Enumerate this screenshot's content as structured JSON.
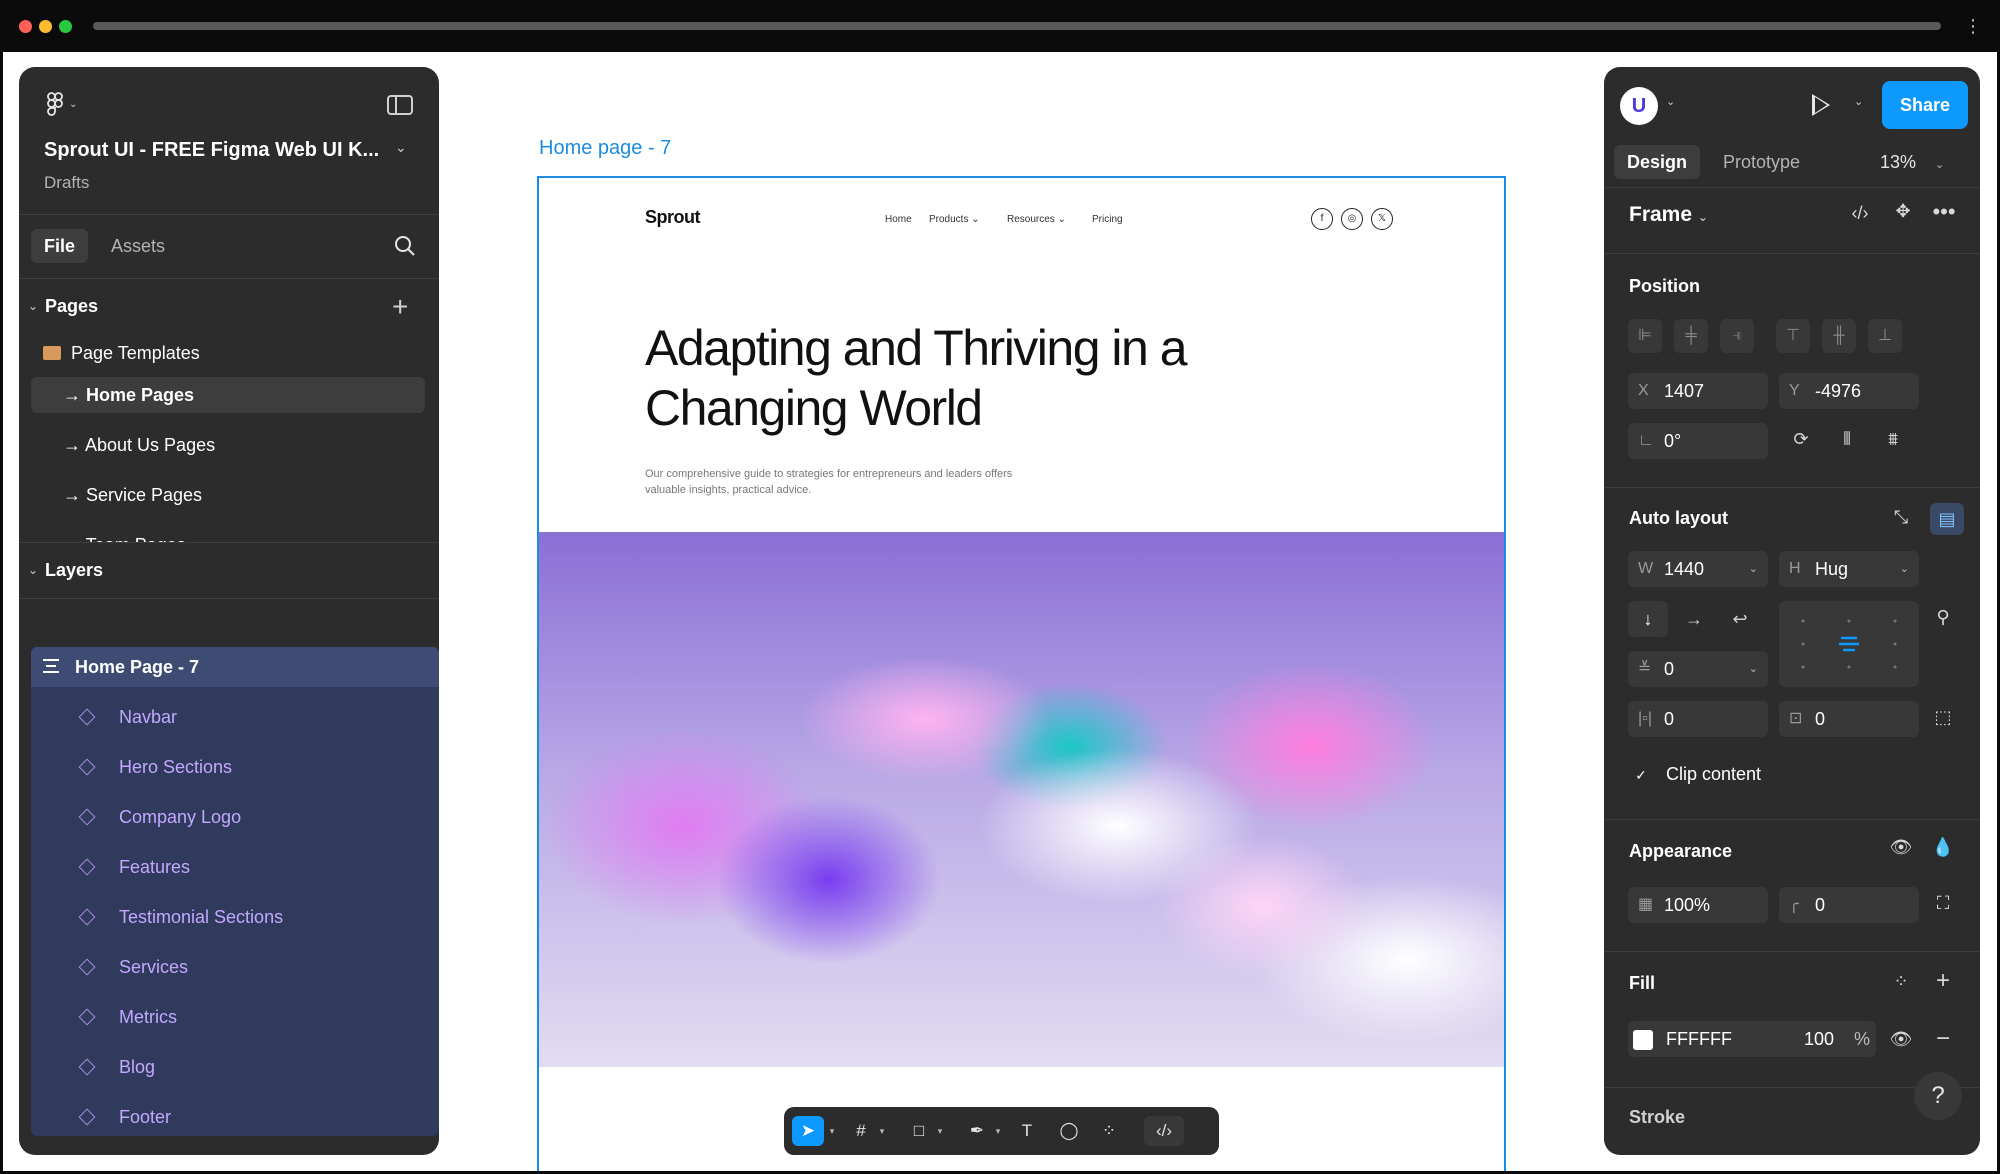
{
  "left_panel": {
    "file_title": "Sprout UI - FREE Figma Web UI K...",
    "file_location": "Drafts",
    "tabs": {
      "file": "File",
      "assets": "Assets"
    },
    "pages_heading": "Pages",
    "pages": [
      "Page Templates",
      "→ Home Pages",
      "→ About Us Pages",
      "→ Service Pages",
      "→ Team Pages"
    ],
    "layers_heading": "Layers",
    "layers_root": "Home Page - 7",
    "layers": [
      "Navbar",
      "Hero Sections",
      "Company Logo",
      "Features",
      "Testimonial Sections",
      "Services",
      "Metrics",
      "Blog",
      "Footer"
    ]
  },
  "canvas": {
    "frame_label": "Home page - 7",
    "site": {
      "logo": "Sprout",
      "nav": [
        "Home",
        "Products",
        "Resources",
        "Pricing"
      ],
      "social": [
        "f",
        "◎",
        "𝕏"
      ],
      "hero_title": "Adapting and Thriving in a Changing World",
      "hero_subtitle": "Our comprehensive guide to strategies for entrepreneurs and leaders offers valuable insights, practical advice."
    }
  },
  "right_panel": {
    "avatar_letter": "U",
    "share_label": "Share",
    "tabs": {
      "design": "Design",
      "prototype": "Prototype"
    },
    "zoom": "13%",
    "frame_type": "Frame",
    "position": {
      "heading": "Position",
      "x_label": "X",
      "x": "1407",
      "y_label": "Y",
      "y": "-4976",
      "rotation": "0°"
    },
    "auto_layout": {
      "heading": "Auto layout",
      "w_label": "W",
      "w": "1440",
      "h_label": "H",
      "h": "Hug",
      "gap": "0",
      "padding_h": "0",
      "padding_v": "0",
      "clip_content": "Clip content"
    },
    "appearance": {
      "heading": "Appearance",
      "opacity": "100%",
      "radius": "0"
    },
    "fill": {
      "heading": "Fill",
      "hex": "FFFFFF",
      "opacity": "100",
      "unit": "%"
    },
    "stroke_heading": "Stroke",
    "help": "?"
  },
  "colors": {
    "accent": "#0d99ff",
    "panel_bg": "#2c2c2c",
    "selection": "#1d8ce0",
    "layer_text": "#c4a7ff"
  }
}
